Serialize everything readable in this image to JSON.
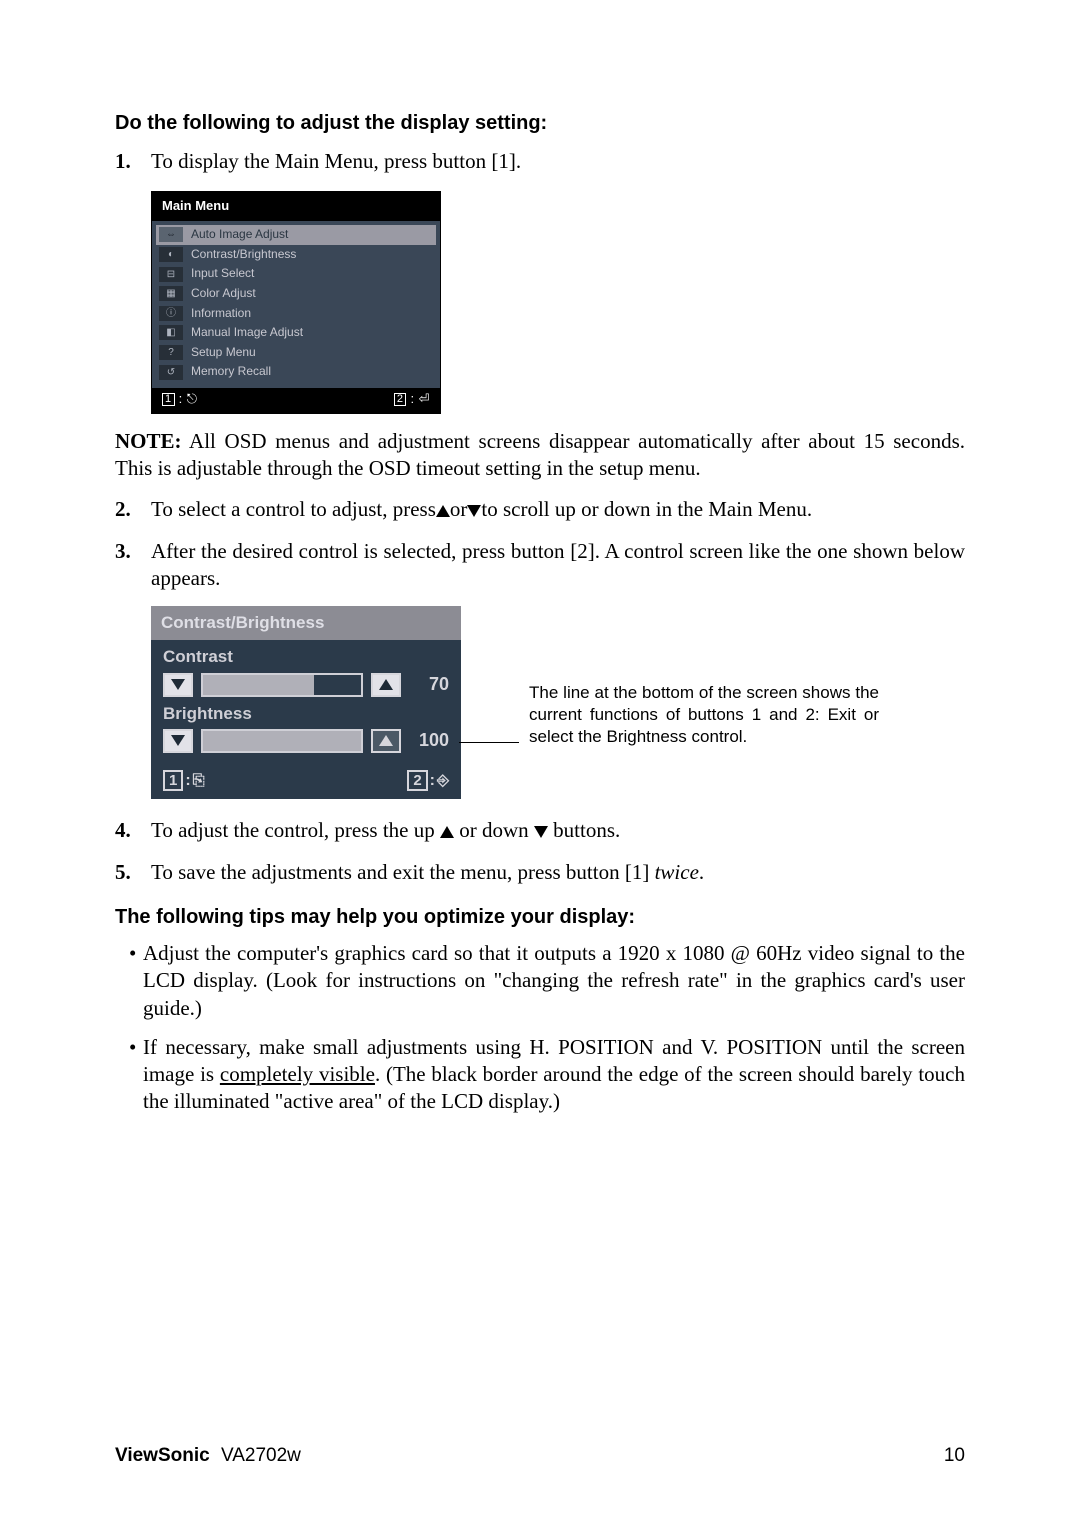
{
  "heading1": "Do the following to adjust the display setting:",
  "step1": {
    "num": "1.",
    "text": "To display the Main Menu, press button [1]."
  },
  "mainmenu": {
    "title": "Main Menu",
    "items": [
      "Auto Image Adjust",
      "Contrast/Brightness",
      "Input Select",
      "Color Adjust",
      "Information",
      "Manual Image Adjust",
      "Setup Menu",
      "Memory Recall"
    ],
    "footer_left_num": "1",
    "footer_right_num": "2"
  },
  "note_label": "NOTE:",
  "note_text": " All OSD menus and adjustment screens disappear automatically after about 15 seconds. This is adjustable through the OSD timeout setting in the setup menu.",
  "step2": {
    "num": "2.",
    "pre": "To select a control to adjust, press",
    "mid": "or",
    "post": "to scroll up or down in the Main Menu."
  },
  "step3": {
    "num": "3.",
    "text": "After the desired control is selected, press button [2]. A control screen like the one shown below appears."
  },
  "cb": {
    "title": "Contrast/Brightness",
    "contrast_label": "Contrast",
    "contrast_value": "70",
    "brightness_label": "Brightness",
    "brightness_value": "100",
    "footer_left": "1",
    "footer_right": "2"
  },
  "callout": "The line at the bottom of the screen shows the current functions of buttons 1 and 2: Exit or select the Brightness control.",
  "step4": {
    "num": "4.",
    "pre": "To adjust the control, press the up ",
    "mid": " or down ",
    "post": " buttons."
  },
  "step5": {
    "num": "5.",
    "pre": "To save the adjustments and exit the menu, press button [1] ",
    "italic": "twice",
    "post": "."
  },
  "heading2": "The following tips may help you optimize your display:",
  "tip1": "Adjust the computer's graphics card so that it outputs a 1920 x 1080 @ 60Hz video signal to the LCD display. (Look for instructions on \"changing the refresh rate\" in the graphics card's user guide.)",
  "tip2_pre": "If necessary, make small adjustments using H. POSITION and V. POSITION until the screen image is ",
  "tip2_underline": "completely visible",
  "tip2_post": ". (The black border around the edge of the screen should barely touch the illuminated \"active area\" of the LCD display.)",
  "footer": {
    "brand": "ViewSonic",
    "model": "VA2702w",
    "page": "10"
  }
}
